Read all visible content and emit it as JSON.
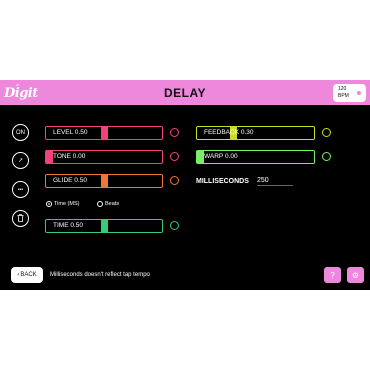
{
  "app": {
    "logo_small": "m",
    "logo_text": "Digit",
    "title": "DELAY",
    "tempo": {
      "value": "120",
      "unit": "BPM"
    }
  },
  "side_buttons": {
    "on_label": "ON",
    "route_icon": "↗",
    "more_icon": "•••",
    "trash_icon": "␡"
  },
  "sliders": {
    "level": {
      "label": "LEVEL 0.50",
      "value": 0.5,
      "color": "#ee4477"
    },
    "tone": {
      "label": "TONE 0.00",
      "value": 0.0,
      "color": "#ee4477"
    },
    "glide": {
      "label": "GLIDE 0.50",
      "value": 0.5,
      "color": "#ee7733"
    },
    "time": {
      "label": "TIME 0.50",
      "value": 0.5,
      "color": "#33cc77"
    },
    "feedback": {
      "label": "FEEDBACK 0.30",
      "value": 0.3,
      "color": "#ccdd22"
    },
    "warp": {
      "label": "WARP 0.00",
      "value": 0.0,
      "color": "#77ee66"
    }
  },
  "time_mode": {
    "options": [
      "Time (MS)",
      "Beats"
    ],
    "selected": "Time (MS)"
  },
  "milliseconds": {
    "label": "MILLISECONDS",
    "value": "250"
  },
  "footer": {
    "back_label": "BACK",
    "message": "Milliseconds doesn't reflect tap tempo",
    "help_icon": "?",
    "settings_icon": "⚙"
  }
}
